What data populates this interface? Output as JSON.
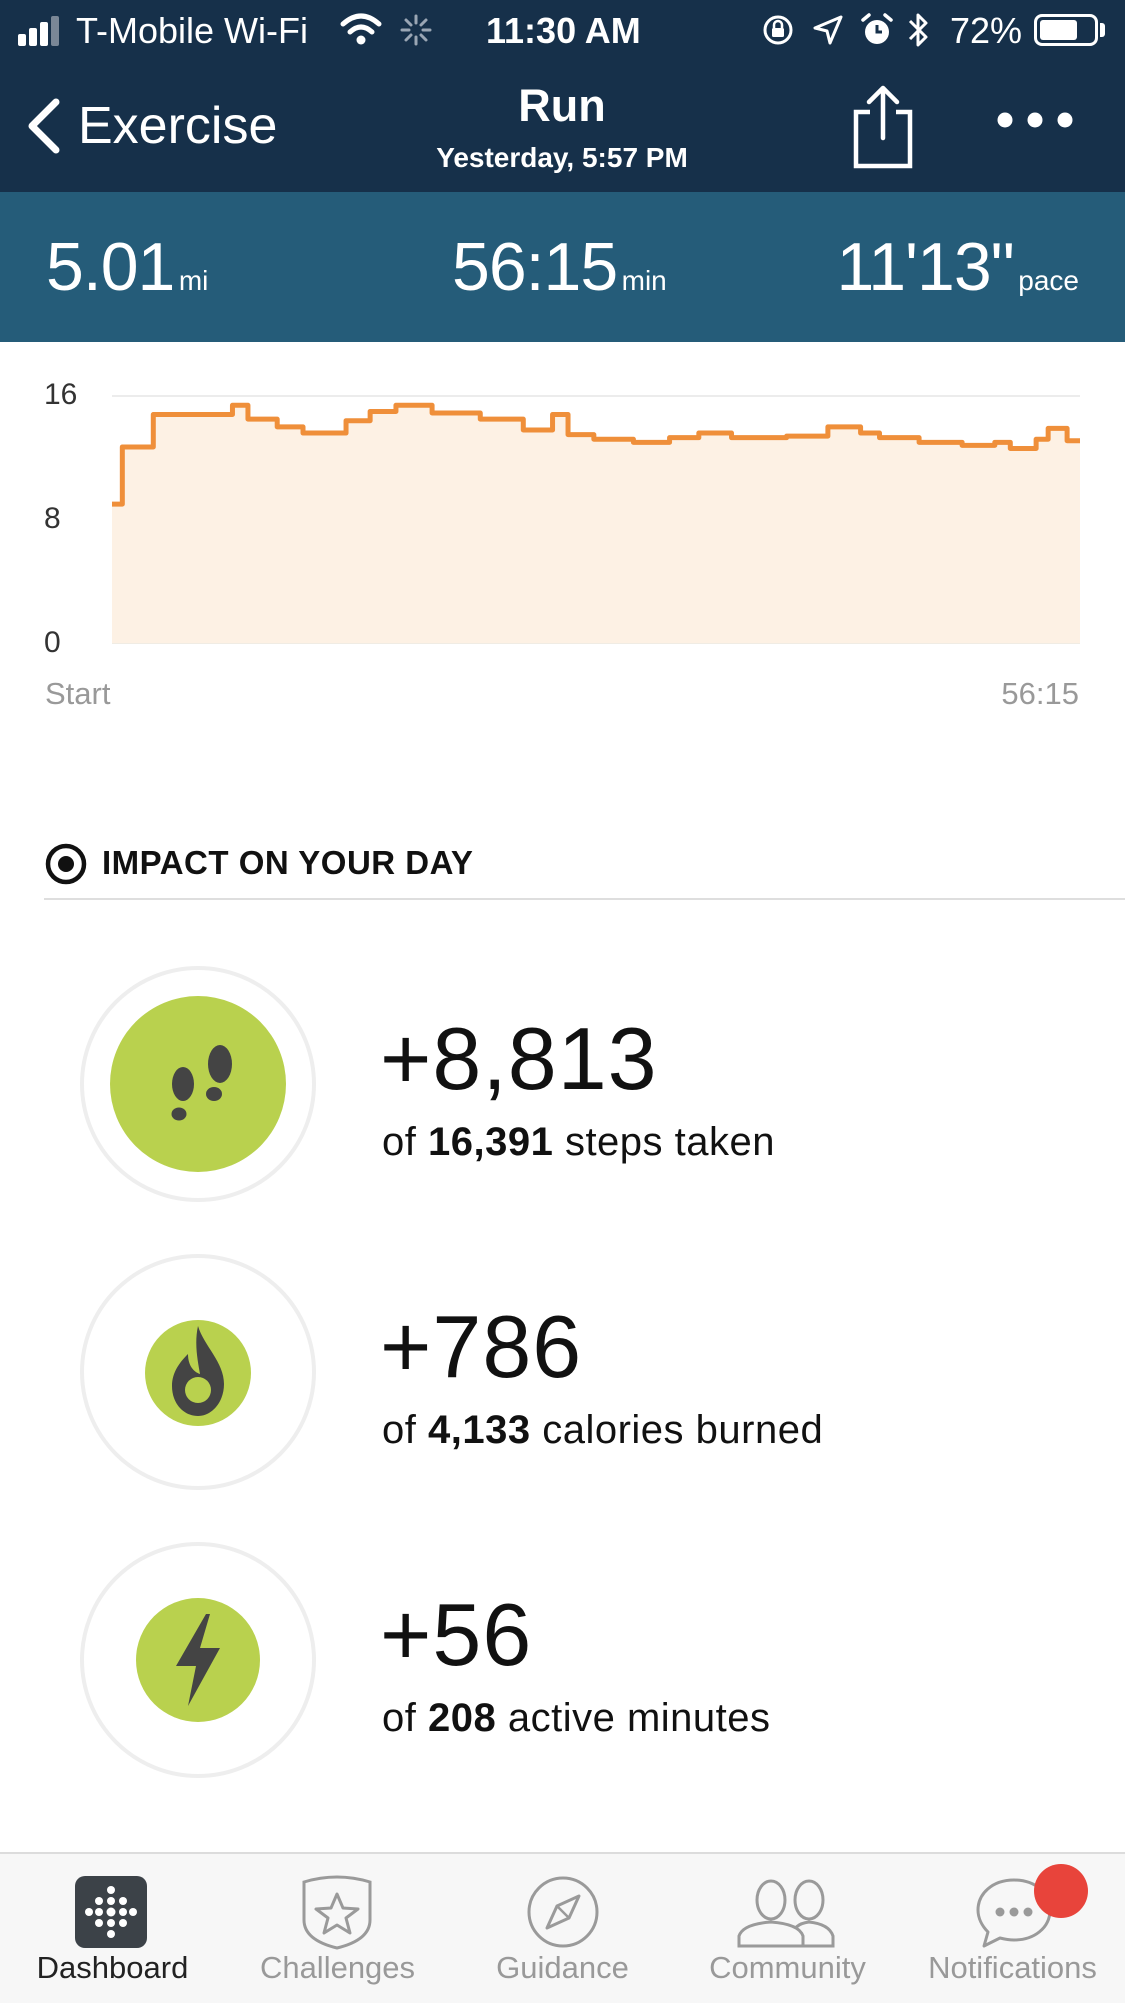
{
  "status_bar": {
    "carrier": "T-Mobile Wi-Fi",
    "time": "11:30 AM",
    "battery": "72%",
    "battery_level": 0.72
  },
  "nav": {
    "back_label": "Exercise",
    "title": "Run",
    "subtitle": "Yesterday, 5:57 PM"
  },
  "summary": {
    "distance_value": "5.01",
    "distance_unit": "mi",
    "duration_value": "56:15",
    "duration_unit": "min",
    "pace_value": "11'13\"",
    "pace_unit": "pace"
  },
  "chart_data": {
    "type": "area",
    "y_ticks": [
      "16",
      "8",
      "0"
    ],
    "ylim": [
      0,
      16
    ],
    "x_start_label": "Start",
    "x_end_label": "56:15",
    "grid": true,
    "x": [
      0,
      0.6,
      0.6,
      2.4,
      2.4,
      7.0,
      7.0,
      7.9,
      7.9,
      9.6,
      9.6,
      11.1,
      11.1,
      13.6,
      13.6,
      15.0,
      15.0,
      16.5,
      16.5,
      18.6,
      18.6,
      21.4,
      21.4,
      23.9,
      23.9,
      25.6,
      25.6,
      26.5,
      26.5,
      28.0,
      28.0,
      30.3,
      30.3,
      32.4,
      32.4,
      34.1,
      34.1,
      36.0,
      36.0,
      39.2,
      39.2,
      41.6,
      41.6,
      43.5,
      43.5,
      44.6,
      44.6,
      46.9,
      46.9,
      49.4,
      49.4,
      51.3,
      51.3,
      52.2,
      52.2,
      53.7,
      53.7,
      54.4,
      54.4,
      55.5,
      55.5,
      56.25
    ],
    "y": [
      9.0,
      9.0,
      12.7,
      12.7,
      14.8,
      14.8,
      15.4,
      15.4,
      14.5,
      14.5,
      14.0,
      14.0,
      13.6,
      13.6,
      14.4,
      14.4,
      15.0,
      15.0,
      15.4,
      15.4,
      14.9,
      14.9,
      14.5,
      14.5,
      13.8,
      13.8,
      14.8,
      14.8,
      13.5,
      13.5,
      13.2,
      13.2,
      13.0,
      13.0,
      13.3,
      13.3,
      13.6,
      13.6,
      13.3,
      13.3,
      13.4,
      13.4,
      14.0,
      14.0,
      13.6,
      13.6,
      13.3,
      13.3,
      13.0,
      13.0,
      12.8,
      12.8,
      13.0,
      13.0,
      12.6,
      12.6,
      13.2,
      13.2,
      13.9,
      13.9,
      13.1,
      13.1
    ],
    "line_color": "#ef8f3a",
    "fill_color": "#fdf1e4"
  },
  "impact": {
    "title": "IMPACT ON YOUR DAY",
    "items": [
      {
        "value": "+8,813",
        "pre": "of ",
        "total": "16,391",
        "post": " steps taken",
        "icon": "footsteps-icon"
      },
      {
        "value": "+786",
        "pre": "of ",
        "total": "4,133",
        "post": " calories burned",
        "icon": "flame-icon"
      },
      {
        "value": "+56",
        "pre": "of ",
        "total": "208",
        "post": " active minutes",
        "icon": "lightning-icon"
      }
    ]
  },
  "tabs": [
    {
      "label": "Dashboard",
      "icon": "dashboard-icon",
      "active": true
    },
    {
      "label": "Challenges",
      "icon": "star-badge-icon",
      "active": false
    },
    {
      "label": "Guidance",
      "icon": "compass-icon",
      "active": false
    },
    {
      "label": "Community",
      "icon": "people-icon",
      "active": false
    },
    {
      "label": "Notifications",
      "icon": "chat-bubble-icon",
      "active": false
    }
  ],
  "colors": {
    "status_bg": "#16304a",
    "summary_bg": "#255c79",
    "accent_green": "#b9d14e",
    "chart_orange": "#ef8f3a",
    "notification_dot": "#e8443b"
  }
}
